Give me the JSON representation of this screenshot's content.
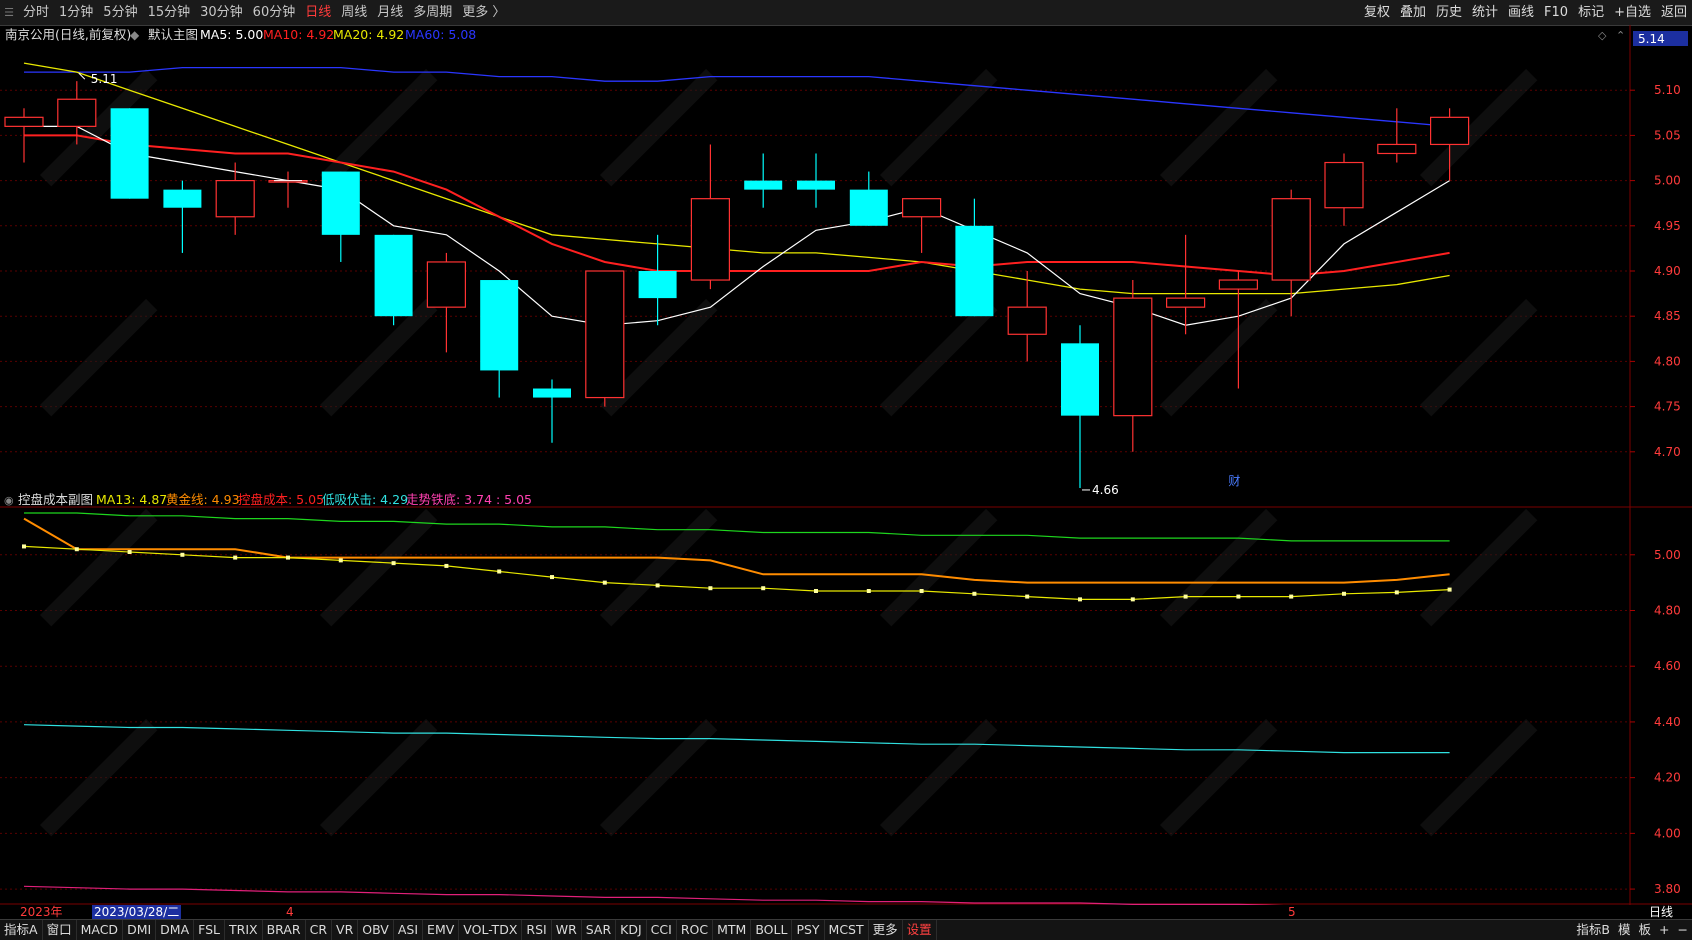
{
  "toolbar": {
    "timeframes": [
      "分时",
      "1分钟",
      "5分钟",
      "15分钟",
      "30分钟",
      "60分钟",
      "日线",
      "周线",
      "月线",
      "多周期",
      "更多 〉"
    ],
    "active_index": 6,
    "right_items": [
      "复权",
      "叠加",
      "历史",
      "统计",
      "画线",
      "F10",
      "标记",
      "+自选",
      "返回"
    ]
  },
  "main_chart": {
    "title": "南京公用(日线,前复权)",
    "subtitle": "默认主图",
    "legend": [
      {
        "label": "MA5: 5.00",
        "color": "#ffffff"
      },
      {
        "label": "MA10: 4.92",
        "color": "#ff2020"
      },
      {
        "label": "MA20: 4.92",
        "color": "#e8e800"
      },
      {
        "label": "MA60: 5.08",
        "color": "#2a36ff"
      }
    ],
    "price_tag": "5.14",
    "y_ticks": [
      "5.10",
      "5.05",
      "5.00",
      "4.95",
      "4.90",
      "4.85",
      "4.80",
      "4.75",
      "4.70"
    ]
  },
  "sub_chart": {
    "title": "控盘成本副图",
    "legend": [
      {
        "label": "MA13: 4.87",
        "color": "#e8e800"
      },
      {
        "label": "黄金线: 4.93",
        "color": "#ff8c00"
      },
      {
        "label": "控盘成本: 5.05",
        "color": "#ff2020"
      },
      {
        "label": "低吸伏击: 4.29",
        "color": "#30e0e0"
      },
      {
        "label": "走势铁底: 3.74 : 5.05",
        "color": "#ff40b0"
      }
    ],
    "y_ticks": [
      "5.00",
      "4.80",
      "4.60",
      "4.40",
      "4.20",
      "4.00",
      "3.80"
    ]
  },
  "dates": {
    "year": "2023年",
    "current": "2023/03/28/二",
    "m4": "4",
    "m5": "5"
  },
  "period_label": "日线",
  "annotations": {
    "high": "5.11",
    "low": "4.66",
    "news": "财"
  },
  "bottom": {
    "indicators": [
      "指标A",
      "窗口",
      "MACD",
      "DMI",
      "DMA",
      "FSL",
      "TRIX",
      "BRAR",
      "CR",
      "VR",
      "OBV",
      "ASI",
      "EMV",
      "VOL-TDX",
      "RSI",
      "WR",
      "SAR",
      "KDJ",
      "CCI",
      "ROC",
      "MTM",
      "BOLL",
      "PSY",
      "MCST",
      "更多",
      "设置"
    ],
    "right": [
      "指标B",
      "模",
      "板",
      "+",
      "−"
    ]
  },
  "colors": {
    "up": "#ff3232",
    "down": "#00ffff",
    "ma5": "#ffffff",
    "ma10": "#ff2020",
    "ma20": "#e8e800",
    "ma60": "#2a36ff",
    "gold": "#ff8c00",
    "ma13": "#e8e800",
    "green": "#1ed61e",
    "cyan": "#30e0e0",
    "pink": "#e0207a"
  },
  "chart_data": [
    {
      "type": "candlestick",
      "title": "南京公用(日线,前复权)",
      "ylim": [
        4.65,
        5.15
      ],
      "candles": [
        {
          "o": 5.06,
          "h": 5.08,
          "l": 5.02,
          "c": 5.07
        },
        {
          "o": 5.06,
          "h": 5.11,
          "l": 5.04,
          "c": 5.09
        },
        {
          "o": 5.08,
          "h": 5.08,
          "l": 4.98,
          "c": 4.98
        },
        {
          "o": 4.99,
          "h": 5.0,
          "l": 4.92,
          "c": 4.97
        },
        {
          "o": 4.96,
          "h": 5.02,
          "l": 4.94,
          "c": 5.0
        },
        {
          "o": 5.0,
          "h": 5.01,
          "l": 4.97,
          "c": 5.0
        },
        {
          "o": 5.01,
          "h": 5.01,
          "l": 4.91,
          "c": 4.94
        },
        {
          "o": 4.94,
          "h": 4.94,
          "l": 4.84,
          "c": 4.85
        },
        {
          "o": 4.86,
          "h": 4.92,
          "l": 4.81,
          "c": 4.91
        },
        {
          "o": 4.89,
          "h": 4.89,
          "l": 4.76,
          "c": 4.79
        },
        {
          "o": 4.77,
          "h": 4.78,
          "l": 4.71,
          "c": 4.76
        },
        {
          "o": 4.76,
          "h": 4.9,
          "l": 4.75,
          "c": 4.9
        },
        {
          "o": 4.9,
          "h": 4.94,
          "l": 4.84,
          "c": 4.87
        },
        {
          "o": 4.89,
          "h": 5.04,
          "l": 4.88,
          "c": 4.98
        },
        {
          "o": 5.0,
          "h": 5.03,
          "l": 4.97,
          "c": 4.99
        },
        {
          "o": 5.0,
          "h": 5.03,
          "l": 4.97,
          "c": 4.99
        },
        {
          "o": 4.99,
          "h": 5.01,
          "l": 4.95,
          "c": 4.95
        },
        {
          "o": 4.96,
          "h": 4.98,
          "l": 4.92,
          "c": 4.98
        },
        {
          "o": 4.95,
          "h": 4.98,
          "l": 4.85,
          "c": 4.85
        },
        {
          "o": 4.83,
          "h": 4.9,
          "l": 4.8,
          "c": 4.86
        },
        {
          "o": 4.82,
          "h": 4.84,
          "l": 4.66,
          "c": 4.74
        },
        {
          "o": 4.74,
          "h": 4.89,
          "l": 4.7,
          "c": 4.87
        },
        {
          "o": 4.86,
          "h": 4.94,
          "l": 4.83,
          "c": 4.87
        },
        {
          "o": 4.88,
          "h": 4.9,
          "l": 4.77,
          "c": 4.89
        },
        {
          "o": 4.89,
          "h": 4.99,
          "l": 4.85,
          "c": 4.98
        },
        {
          "o": 4.97,
          "h": 5.03,
          "l": 4.95,
          "c": 5.02
        },
        {
          "o": 5.03,
          "h": 5.08,
          "l": 5.02,
          "c": 5.04
        },
        {
          "o": 5.04,
          "h": 5.08,
          "l": 5.0,
          "c": 5.07
        }
      ],
      "ma5": [
        5.06,
        5.06,
        5.03,
        5.02,
        5.01,
        5.0,
        4.99,
        4.95,
        4.94,
        4.9,
        4.85,
        4.84,
        4.845,
        4.86,
        4.905,
        4.945,
        4.955,
        4.97,
        4.945,
        4.92,
        4.875,
        4.86,
        4.84,
        4.85,
        4.87,
        4.93,
        4.965,
        5.0
      ],
      "ma10": [
        5.05,
        5.05,
        5.04,
        5.035,
        5.03,
        5.03,
        5.02,
        5.01,
        4.99,
        4.96,
        4.93,
        4.91,
        4.9,
        4.9,
        4.9,
        4.9,
        4.9,
        4.91,
        4.905,
        4.91,
        4.91,
        4.91,
        4.905,
        4.9,
        4.895,
        4.9,
        4.91,
        4.92
      ],
      "ma20": [
        5.13,
        5.12,
        5.1,
        5.08,
        5.06,
        5.04,
        5.02,
        5.0,
        4.98,
        4.96,
        4.94,
        4.935,
        4.93,
        4.925,
        4.92,
        4.92,
        4.915,
        4.91,
        4.9,
        4.89,
        4.88,
        4.875,
        4.875,
        4.875,
        4.875,
        4.88,
        4.885,
        4.895
      ],
      "ma60": [
        5.12,
        5.12,
        5.12,
        5.125,
        5.125,
        5.125,
        5.125,
        5.12,
        5.12,
        5.115,
        5.115,
        5.11,
        5.11,
        5.115,
        5.115,
        5.115,
        5.115,
        5.11,
        5.105,
        5.1,
        5.095,
        5.09,
        5.085,
        5.08,
        5.075,
        5.07,
        5.065,
        5.06
      ]
    },
    {
      "type": "line",
      "title": "控盘成本副图",
      "ylim": [
        3.75,
        5.15
      ],
      "series": [
        {
          "name": "黄金线",
          "values": [
            5.13,
            5.02,
            5.02,
            5.02,
            5.02,
            4.99,
            4.99,
            4.99,
            4.99,
            4.99,
            4.99,
            4.99,
            4.99,
            4.98,
            4.93,
            4.93,
            4.93,
            4.93,
            4.91,
            4.9,
            4.9,
            4.9,
            4.9,
            4.9,
            4.9,
            4.9,
            4.91,
            4.93
          ]
        },
        {
          "name": "MA13",
          "values": [
            5.03,
            5.02,
            5.01,
            5.0,
            4.99,
            4.99,
            4.98,
            4.97,
            4.96,
            4.94,
            4.92,
            4.9,
            4.89,
            4.88,
            4.88,
            4.87,
            4.87,
            4.87,
            4.86,
            4.85,
            4.84,
            4.84,
            4.85,
            4.85,
            4.85,
            4.86,
            4.865,
            4.875
          ]
        },
        {
          "name": "控盘成本",
          "values": [
            5.15,
            5.15,
            5.14,
            5.14,
            5.13,
            5.13,
            5.12,
            5.12,
            5.11,
            5.11,
            5.1,
            5.1,
            5.09,
            5.09,
            5.08,
            5.08,
            5.08,
            5.07,
            5.07,
            5.07,
            5.06,
            5.06,
            5.06,
            5.06,
            5.05,
            5.05,
            5.05,
            5.05
          ]
        },
        {
          "name": "低吸伏击",
          "values": [
            4.39,
            4.385,
            4.38,
            4.38,
            4.375,
            4.37,
            4.365,
            4.36,
            4.36,
            4.355,
            4.35,
            4.345,
            4.34,
            4.34,
            4.335,
            4.33,
            4.325,
            4.32,
            4.32,
            4.315,
            4.31,
            4.305,
            4.3,
            4.3,
            4.295,
            4.29,
            4.29,
            4.29
          ]
        },
        {
          "name": "走势铁底",
          "values": [
            3.81,
            3.805,
            3.8,
            3.8,
            3.795,
            3.79,
            3.79,
            3.785,
            3.78,
            3.78,
            3.775,
            3.77,
            3.77,
            3.765,
            3.76,
            3.76,
            3.755,
            3.755,
            3.75,
            3.75,
            3.75,
            3.745,
            3.745,
            3.745,
            3.74,
            3.74,
            3.74,
            3.74
          ]
        }
      ]
    }
  ]
}
